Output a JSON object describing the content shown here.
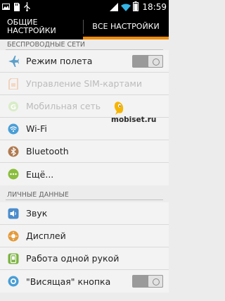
{
  "status_bar": {
    "time": "18:59",
    "left_icons": [
      "photo-icon",
      "sd-card-icon",
      "usb-icon"
    ],
    "right_icons": [
      "signal-icon",
      "wifi-icon",
      "battery-icon"
    ]
  },
  "tabs": {
    "general_line1": "ОБЩИЕ",
    "general_line2": "НАСТРОЙКИ",
    "all": "ВСЕ НАСТРОЙКИ",
    "active": "all"
  },
  "sections": {
    "wireless": "БЕСПРОВОДНЫЕ СЕТИ",
    "personal": "ЛИЧНЫЕ ДАННЫЕ"
  },
  "wireless_items": [
    {
      "label": "Режим полета",
      "icon": "airplane-icon",
      "toggle": true,
      "toggle_on": false
    },
    {
      "label": "Управление SIM-картами",
      "icon": "sim-icon",
      "disabled": true
    },
    {
      "label": "Мобильная сеть",
      "icon": "mobile-network-icon",
      "disabled": true
    },
    {
      "label": "Wi-Fi",
      "icon": "wifi-icon"
    },
    {
      "label": "Bluetooth",
      "icon": "bluetooth-icon"
    },
    {
      "label": "Ещё...",
      "icon": "more-icon"
    }
  ],
  "personal_items": [
    {
      "label": "Звук",
      "icon": "sound-icon"
    },
    {
      "label": "Дисплей",
      "icon": "display-icon"
    },
    {
      "label": "Работа одной рукой",
      "icon": "one-hand-icon"
    },
    {
      "label": "\"Висящая\" кнопка",
      "icon": "floating-button-icon",
      "toggle": true,
      "toggle_on": false
    }
  ],
  "watermark": "mobiset.ru",
  "colors": {
    "accent": "#f08c00",
    "status_bar": "#000000",
    "background": "#ececec"
  }
}
